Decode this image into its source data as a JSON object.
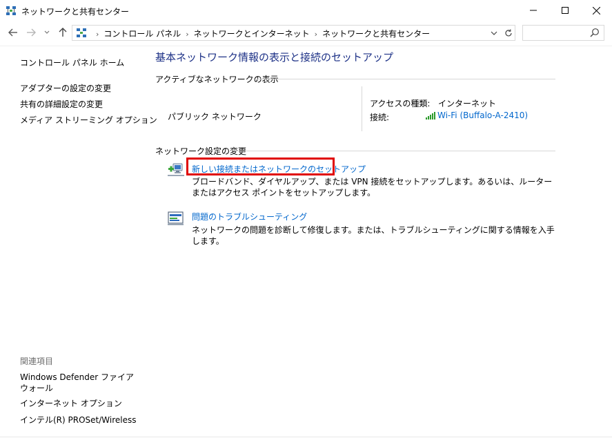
{
  "window": {
    "title": "ネットワークと共有センター"
  },
  "navigation": {
    "breadcrumbs": [
      "コントロール パネル",
      "ネットワークとインターネット",
      "ネットワークと共有センター"
    ],
    "search": {
      "placeholder": "",
      "value": ""
    }
  },
  "left_pane": {
    "links": [
      "コントロール パネル ホーム",
      "アダプターの設定の変更",
      "共有の詳細設定の変更",
      "メディア ストリーミング オプション"
    ],
    "related_heading": "関連項目",
    "related_links": [
      "Windows Defender ファイアウォール",
      "インターネット オプション",
      "インテル(R) PROSet/Wireless"
    ]
  },
  "main": {
    "title": "基本ネットワーク情報の表示と接続のセットアップ",
    "active_networks": {
      "heading": "アクティブなネットワークの表示",
      "network_name": "パブリック ネットワーク",
      "access_type_label": "アクセスの種類:",
      "access_type_value": "インターネット",
      "connection_label": "接続:",
      "connection_value": "Wi-Fi (Buffalo-A-2410)"
    },
    "change_settings": {
      "heading": "ネットワーク設定の変更",
      "tasks": [
        {
          "link": "新しい接続またはネットワークのセットアップ",
          "description": "ブロードバンド、ダイヤルアップ、または VPN 接続をセットアップします。あるいは、ルーターまたはアクセス ポイントをセットアップします。",
          "icon": "network-setup-icon"
        },
        {
          "link": "問題のトラブルシューティング",
          "description": "ネットワークの問題を診断して修復します。または、トラブルシューティングに関する情報を入手します。",
          "icon": "troubleshoot-icon"
        }
      ]
    }
  },
  "colors": {
    "title": "#1e3287",
    "link": "#0066cc",
    "highlight": "#e00000",
    "wifi": "#2a9a2a"
  }
}
